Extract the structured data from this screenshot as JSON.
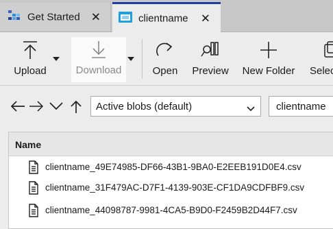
{
  "tabs": [
    {
      "label": "Get Started",
      "icon": "storage-explorer-icon",
      "active": false
    },
    {
      "label": "clientname",
      "icon": "blob-container-icon",
      "active": true
    }
  ],
  "toolbar": {
    "upload_label": "Upload",
    "download_label": "Download",
    "open_label": "Open",
    "preview_label": "Preview",
    "new_folder_label": "New Folder",
    "select_label": "Select"
  },
  "address": {
    "view_select_value": "Active blobs (default)",
    "path_value": "clientname"
  },
  "file_list": {
    "column_name": "Name",
    "rows": [
      {
        "name": "clientname_49E74985-DF66-43B1-9BA0-E2EEB191D0E4.csv",
        "icon": "document-icon"
      },
      {
        "name": "clientname_31F479AC-D7F1-4139-903E-CF1DA9CDFBF9.csv",
        "icon": "document-icon"
      },
      {
        "name": "clientname_44098787-9981-4CA5-B9D0-F2459B2D44F7.csv",
        "icon": "document-icon"
      }
    ]
  },
  "colors": {
    "active_tab_accent": "#1f3e9c",
    "background": "#ececec"
  }
}
